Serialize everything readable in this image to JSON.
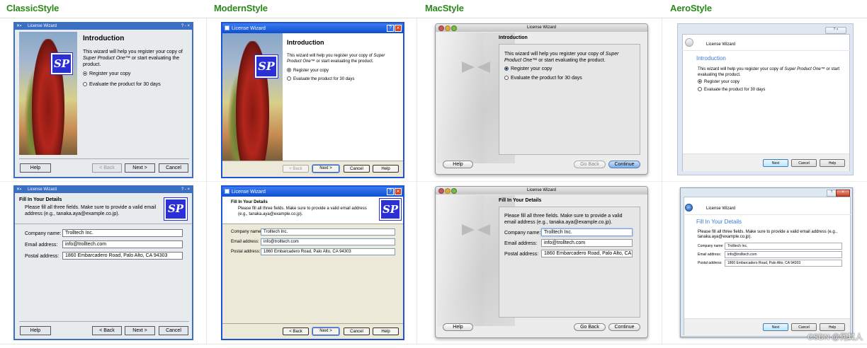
{
  "styles": {
    "classic": "ClassicStyle",
    "modern": "ModernStyle",
    "mac": "MacStyle",
    "aero": "AeroStyle"
  },
  "window_title": "License Wizard",
  "intro": {
    "title": "Introduction",
    "text_pre": "This wizard will help you register your copy of ",
    "product": "Super Product One™",
    "text_post": " or start evaluating the product.",
    "option_register": "Register your copy",
    "option_evaluate": "Evaluate the product for 30 days"
  },
  "details": {
    "title": "Fill In Your Details",
    "text": "Please fill all three fields. Make sure to provide a valid email address (e.g., tanaka.aya@example.co.jp).",
    "company_label": "Company name:",
    "company_value": "Trolltech Inc.",
    "email_label": "Email address:",
    "email_value": "info@trolltech.com",
    "postal_label": "Postal address:",
    "postal_value": "1860 Embarcadero Road, Palo Alto, CA 94303",
    "postal_value_mac": "1860 Embarcadero Road, Palo Alto, CA 94"
  },
  "buttons": {
    "help": "Help",
    "back": "< Back",
    "next": "Next >",
    "cancel": "Cancel",
    "go_back": "Go Back",
    "continue": "Continue",
    "next_plain": "Next"
  },
  "logo_text": "SP",
  "titlebar_controls": {
    "classic": "? - ×",
    "modern_help": "?",
    "modern_close": "×",
    "aero": "? ×"
  },
  "watermark": "CSDN @何其人",
  "colors": {
    "header_green": "#2a8a1a",
    "kde_blue": "#3a6fc4",
    "xp_blue": "#1f52d6",
    "logo_blue": "#2a2fd6",
    "aero_link": "#3a7bd5"
  }
}
